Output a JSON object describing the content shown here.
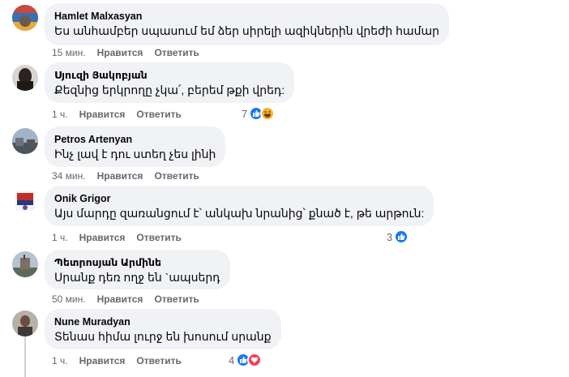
{
  "comments": [
    {
      "author": "Hamlet Malxasyan",
      "text": "Ես անհամբեր սպասում եմ ձեր սիրելի ազիկներին վրեժի համար",
      "time": "15 мин.",
      "like": "Нравится",
      "reply": "Ответить",
      "reactions_count": ""
    },
    {
      "author": "Սյուզի Յակոբյան",
      "text": "Քեզնից երկրողը չկա՛, բերեմ թքի վրեդ:",
      "time": "1 ч.",
      "like": "Нравится",
      "reply": "Ответить",
      "reactions_count": "7",
      "reaction_icons": [
        "like-icon",
        "haha-icon"
      ]
    },
    {
      "author": "Petros Artenyan",
      "text": "Ինչ լավ է դու ստեղ չես լինի",
      "time": "34 мин.",
      "like": "Нравится",
      "reply": "Ответить",
      "reactions_count": ""
    },
    {
      "author": "Onik Grigor",
      "text": "Այս մարդը զառանցում է՝ անկախ նրանից՝ քնած է, թե արթուն:",
      "time": "1 ч.",
      "like": "Нравится",
      "reply": "Ответить",
      "reactions_count": "3",
      "reaction_icons": [
        "like-icon"
      ]
    },
    {
      "author": "Պետրոսյան Արմինե",
      "text": "Սրանք դեռ ողջ են `ապսերդ",
      "time": "50 мин.",
      "like": "Нравится",
      "reply": "Ответить",
      "reactions_count": ""
    },
    {
      "author": "Nune Muradyan",
      "text": "Տենաս հիմա լուրջ են խոսում սրանք",
      "time": "1 ч.",
      "like": "Нравится",
      "reply": "Ответить",
      "reactions_count": "4",
      "reaction_icons": [
        "like-icon",
        "love-icon"
      ]
    }
  ],
  "colors": {
    "bubble": "#f0f2f5",
    "meta": "#65676b",
    "like_blue": "#1877f2",
    "love_red": "#f33e58",
    "haha_yellow": "#f7b125"
  }
}
